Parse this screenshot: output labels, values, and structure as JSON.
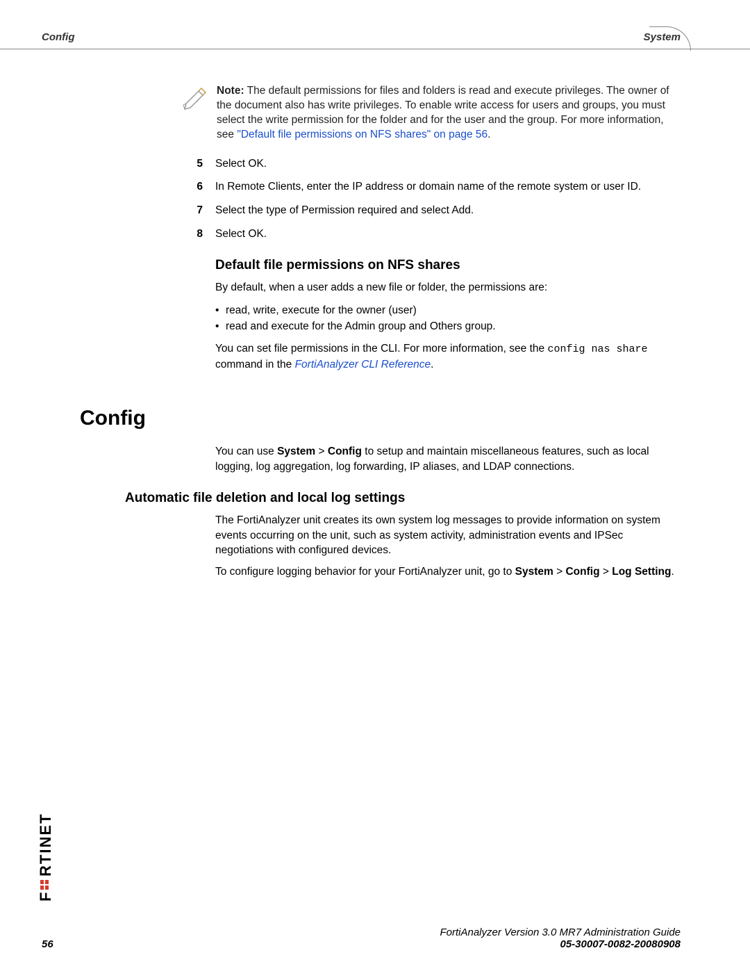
{
  "header": {
    "left": "Config",
    "right": "System"
  },
  "note": {
    "label": "Note:",
    "text": " The default permissions for files and folders is read and execute privileges. The owner of the document also has write privileges. To enable write access for users and groups, you must select the write permission for the folder and for the user and the group. For more information, see ",
    "link": "\"Default file permissions on NFS shares\" on page 56",
    "tail": "."
  },
  "steps": [
    {
      "num": "5",
      "text": "Select OK."
    },
    {
      "num": "6",
      "text": "In Remote Clients, enter the IP address or domain name of the remote system or user ID."
    },
    {
      "num": "7",
      "text": "Select the type of Permission required and select Add."
    },
    {
      "num": "8",
      "text": "Select OK."
    }
  ],
  "nfs": {
    "heading": "Default file permissions on NFS shares",
    "intro": "By default, when a user adds a new file or folder, the permissions are:",
    "bullet1": "read, write, execute for the owner (user)",
    "bullet2": "read and execute for the Admin group and Others group.",
    "cli_pre": "You can set file permissions in the CLI. For more information, see the ",
    "cli_code1": "config nas share",
    "cli_mid": " command in the ",
    "cli_link": "FortiAnalyzer CLI Reference",
    "cli_tail": "."
  },
  "config": {
    "heading": "Config",
    "para_pre": "You can use ",
    "para_b1": "System",
    "para_mid1": " > ",
    "para_b2": "Config",
    "para_tail": " to setup and maintain miscellaneous features, such as local logging, log aggregation, log forwarding, IP aliases, and LDAP connections."
  },
  "auto": {
    "heading": "Automatic file deletion and local log settings",
    "para1": "The FortiAnalyzer unit creates its own system log messages to provide information on system events occurring on the unit, such as system activity, administration events and IPSec negotiations with configured devices.",
    "para2_pre": "To configure logging behavior for your FortiAnalyzer unit, go to ",
    "para2_b1": "System",
    "para2_mid1": " > ",
    "para2_b2": "Config",
    "para2_mid2": " > ",
    "para2_b3": "Log Setting",
    "para2_tail": "."
  },
  "footer": {
    "page": "56",
    "line1": "FortiAnalyzer Version 3.0 MR7 Administration Guide",
    "line2": "05-30007-0082-20080908"
  }
}
